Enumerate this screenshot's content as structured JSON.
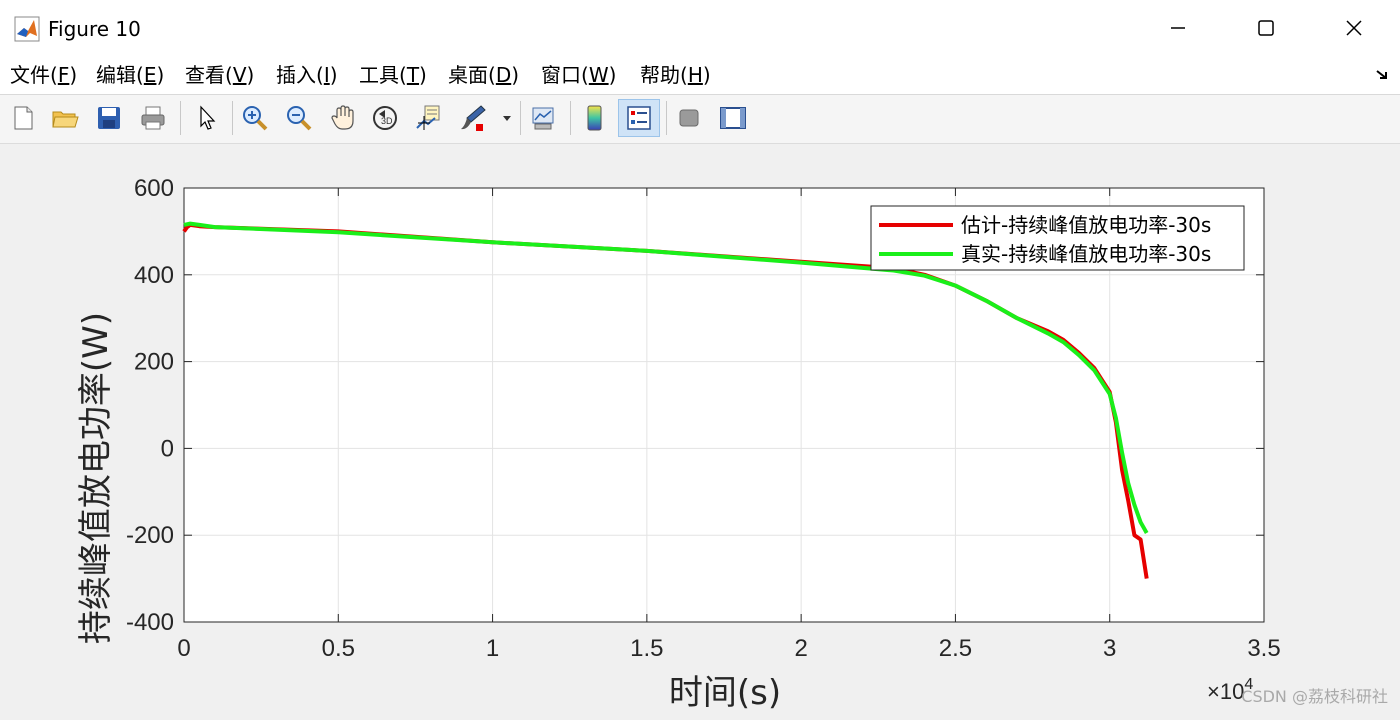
{
  "window": {
    "title": "Figure 10",
    "icon": "matlab-icon"
  },
  "menu": {
    "items": [
      {
        "label": "文件",
        "key": "F"
      },
      {
        "label": "编辑",
        "key": "E"
      },
      {
        "label": "查看",
        "key": "V"
      },
      {
        "label": "插入",
        "key": "I"
      },
      {
        "label": "工具",
        "key": "T"
      },
      {
        "label": "桌面",
        "key": "D"
      },
      {
        "label": "窗口",
        "key": "W"
      },
      {
        "label": "帮助",
        "key": "H"
      }
    ]
  },
  "toolbar": {
    "buttons": [
      "new-file-icon",
      "open-folder-icon",
      "save-icon",
      "print-icon",
      "pointer-icon",
      "zoom-in-icon",
      "zoom-out-icon",
      "pan-hand-icon",
      "rotate-3d-icon",
      "data-cursor-icon",
      "brush-icon",
      "link-plot-icon",
      "colorbar-icon",
      "legend-icon",
      "hide-plot-tools-icon",
      "show-plot-tools-icon"
    ]
  },
  "chart_data": {
    "type": "line",
    "xlabel": "时间(s)",
    "ylabel": "持续峰值放电功率(W)",
    "x_exponent_label": "×10",
    "x_exponent_power": "4",
    "xlim": [
      0,
      3.5
    ],
    "ylim": [
      -400,
      600
    ],
    "xticks": [
      "0",
      "0.5",
      "1",
      "1.5",
      "2",
      "2.5",
      "3",
      "3.5"
    ],
    "yticks": [
      "600",
      "400",
      "200",
      "0",
      "-200",
      "-400"
    ],
    "grid": true,
    "legend_position": "top-right",
    "series": [
      {
        "name": "估计-持续峰值放电功率-30s",
        "color": "#e60000",
        "x": [
          0,
          0.01,
          0.02,
          0.05,
          0.1,
          0.5,
          1.0,
          1.5,
          2.0,
          2.3,
          2.4,
          2.5,
          2.6,
          2.7,
          2.8,
          2.85,
          2.9,
          2.95,
          3.0,
          3.02,
          3.04,
          3.06,
          3.08,
          3.1,
          3.12
        ],
        "y": [
          500,
          510,
          515,
          512,
          510,
          500,
          475,
          455,
          430,
          415,
          400,
          375,
          340,
          300,
          270,
          250,
          220,
          185,
          130,
          60,
          -50,
          -120,
          -200,
          -210,
          -300
        ]
      },
      {
        "name": "真实-持续峰值放电功率-30s",
        "color": "#1aef1a",
        "x": [
          0,
          0.02,
          0.05,
          0.1,
          0.5,
          1.0,
          1.5,
          2.0,
          2.3,
          2.4,
          2.5,
          2.6,
          2.7,
          2.8,
          2.85,
          2.9,
          2.95,
          3.0,
          3.02,
          3.04,
          3.06,
          3.08,
          3.1,
          3.12
        ],
        "y": [
          515,
          518,
          515,
          510,
          498,
          475,
          455,
          428,
          410,
          398,
          375,
          340,
          300,
          265,
          245,
          215,
          180,
          125,
          70,
          -10,
          -80,
          -130,
          -170,
          -195
        ]
      }
    ]
  },
  "watermark": "CSDN @荔枝科研社"
}
